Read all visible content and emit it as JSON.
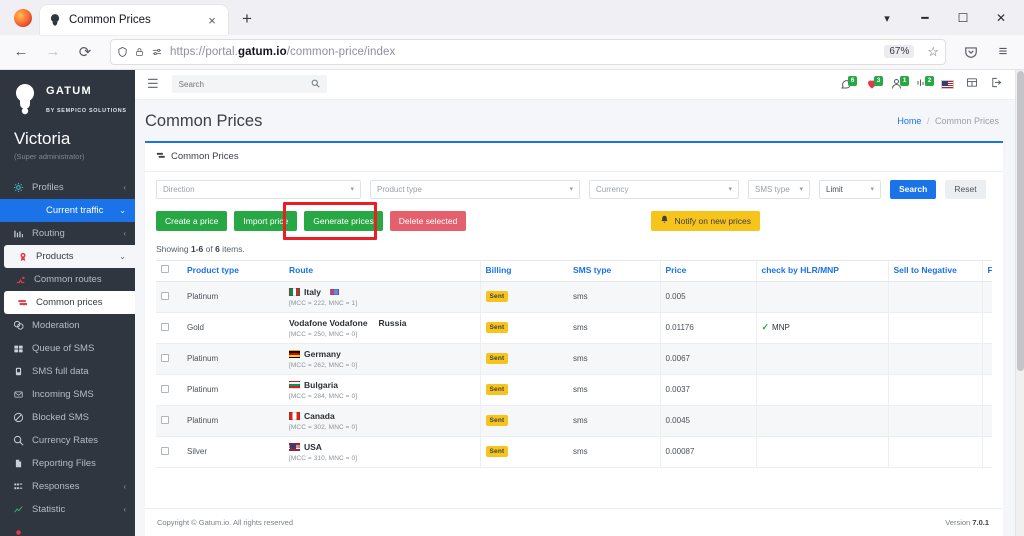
{
  "browser": {
    "tab": {
      "title": "Common Prices",
      "favicon": "gatum-favicon",
      "close_label": "×"
    },
    "new_tab_label": "+",
    "window_controls": {
      "list_all_tabs": "⌄",
      "minimize": "—",
      "maximize": "❐",
      "close": "✕"
    },
    "nav": {
      "back": "←",
      "forward": "→",
      "reload": "↻"
    },
    "url": {
      "scheme": "https://portal.",
      "domain": "gatum.io",
      "path": "/common-price/index"
    },
    "zoom_level": "67%",
    "bookmark_label": "☆",
    "pocket_label": "pocket-icon",
    "appmenu_label": "≡"
  },
  "sidebar": {
    "brand_name": "GATUM",
    "brand_sub": "BY SEMPICO SOLUTIONS",
    "user_name": "Victoria",
    "user_role": "(Super administrator)",
    "items": [
      {
        "label": "Profiles",
        "icon": "profiles-icon",
        "arrow": "‹",
        "state": "normal"
      },
      {
        "label": "Current traffic",
        "icon": "",
        "arrow": "⌄",
        "state": "active"
      },
      {
        "label": "Routing",
        "icon": "routing-icon",
        "arrow": "‹",
        "state": "normal"
      },
      {
        "label": "Products",
        "icon": "products-icon",
        "arrow": "⌄",
        "state": "open"
      },
      {
        "label": "Common routes",
        "icon": "common-routes-icon",
        "arrow": "",
        "state": "sub"
      },
      {
        "label": "Common prices",
        "icon": "common-prices-icon",
        "arrow": "",
        "state": "current"
      },
      {
        "label": "Moderation",
        "icon": "moderation-icon",
        "arrow": "",
        "state": "normal"
      },
      {
        "label": "Queue of SMS",
        "icon": "queue-icon",
        "arrow": "",
        "state": "normal"
      },
      {
        "label": "SMS full data",
        "icon": "sms-full-data-icon",
        "arrow": "",
        "state": "normal"
      },
      {
        "label": "Incoming SMS",
        "icon": "incoming-sms-icon",
        "arrow": "",
        "state": "normal"
      },
      {
        "label": "Blocked SMS",
        "icon": "blocked-sms-icon",
        "arrow": "",
        "state": "normal"
      },
      {
        "label": "Currency Rates",
        "icon": "currency-rates-icon",
        "arrow": "",
        "state": "normal"
      },
      {
        "label": "Reporting Files",
        "icon": "reporting-files-icon",
        "arrow": "",
        "state": "normal"
      },
      {
        "label": "Responses",
        "icon": "responses-icon",
        "arrow": "‹",
        "state": "normal"
      },
      {
        "label": "Statistic",
        "icon": "statistic-icon",
        "arrow": "‹",
        "state": "normal"
      }
    ]
  },
  "topbar": {
    "menu_toggle": "☰",
    "search_placeholder": "Search",
    "search_value": "",
    "search_icon": "search-icon",
    "notifications": [
      {
        "icon": "chat-icon",
        "count": "6"
      },
      {
        "icon": "alert-icon",
        "count": "3"
      },
      {
        "icon": "user-icon",
        "count": "1"
      },
      {
        "icon": "signal-icon",
        "count": "2"
      }
    ],
    "language_flag": "us-flag",
    "grid_icon": "grid-icon",
    "logout_icon": "logout-icon"
  },
  "page": {
    "title": "Common Prices",
    "breadcrumb": {
      "home": "Home",
      "separator": "/",
      "current": "Common Prices"
    },
    "panel_title": "Common Prices",
    "panel_icon": "table-icon"
  },
  "filters": {
    "direction": "Direction",
    "product_type": "Product type",
    "currency": "Currency",
    "sms_type": "SMS type",
    "limit": "Limit",
    "search_button": "Search",
    "reset_button": "Reset"
  },
  "actions": {
    "create": "Create a price",
    "import": "Import price",
    "generate": "Generate prices",
    "delete": "Delete selected",
    "notify": "Notify on new prices",
    "notify_icon": "bell-icon",
    "highlight_color": "#ee1c24",
    "highlight_target": "Generate prices"
  },
  "table": {
    "showing_prefix": "Showing ",
    "showing_range": "1-6",
    "showing_mid": " of ",
    "showing_total": "6",
    "showing_suffix": " items.",
    "columns": [
      "Product type",
      "Route",
      "Billing",
      "SMS type",
      "Price",
      "check by HLR/MNP",
      "Sell to Negative",
      "Features"
    ],
    "rows": [
      {
        "product_type": "Platinum",
        "route_name": "Italy",
        "route_flag": "it",
        "route_extra_flag": "eu",
        "route_meta": "[MCC = 222, MNC = 1]",
        "operator": "",
        "billing": "Sent",
        "sms_type": "sms",
        "price": "0.005",
        "hlr_mnp": "",
        "sell_to_negative": "",
        "features": "",
        "edit_icon": "edit-icon"
      },
      {
        "product_type": "Gold",
        "route_name": "Vodafone Vodafone",
        "route_flag": "",
        "route_extra_flag": "",
        "route_meta": "[MCC = 250, MNC = 0]",
        "operator": "Russia",
        "billing": "Sent",
        "sms_type": "sms",
        "price": "0.01176",
        "hlr_mnp": "MNP",
        "sell_to_negative": "",
        "features": "",
        "edit_icon": "edit-icon"
      },
      {
        "product_type": "Platinum",
        "route_name": "Germany",
        "route_flag": "de",
        "route_extra_flag": "",
        "route_meta": "[MCC = 262, MNC = 0]",
        "operator": "",
        "billing": "Sent",
        "sms_type": "sms",
        "price": "0.0067",
        "hlr_mnp": "",
        "sell_to_negative": "",
        "features": "",
        "edit_icon": "edit-icon"
      },
      {
        "product_type": "Platinum",
        "route_name": "Bulgaria",
        "route_flag": "bg",
        "route_extra_flag": "",
        "route_meta": "[MCC = 284, MNC = 0]",
        "operator": "",
        "billing": "Sent",
        "sms_type": "sms",
        "price": "0.0037",
        "hlr_mnp": "",
        "sell_to_negative": "",
        "features": "",
        "edit_icon": "edit-icon"
      },
      {
        "product_type": "Platinum",
        "route_name": "Canada",
        "route_flag": "ca",
        "route_extra_flag": "",
        "route_meta": "[MCC = 302, MNC = 0]",
        "operator": "",
        "billing": "Sent",
        "sms_type": "sms",
        "price": "0.0045",
        "hlr_mnp": "",
        "sell_to_negative": "",
        "features": "",
        "edit_icon": "edit-icon"
      },
      {
        "product_type": "Silver",
        "route_name": "USA",
        "route_flag": "us",
        "route_extra_flag": "",
        "route_meta": "[MCC = 310, MNC = 0]",
        "operator": "",
        "billing": "Sent",
        "sms_type": "sms",
        "price": "0.00087",
        "hlr_mnp": "",
        "sell_to_negative": "",
        "features": "",
        "edit_icon": "edit-icon"
      }
    ]
  },
  "footer": {
    "copyright": "Copyright © Gatum.io. All rights reserved",
    "version_label": "Version ",
    "version": "7.0.1"
  },
  "colors": {
    "accent": "#1a73e8",
    "success": "#28a745",
    "danger": "#e4606d",
    "warning": "#f7c41c",
    "sidebar": "#2f3640"
  }
}
